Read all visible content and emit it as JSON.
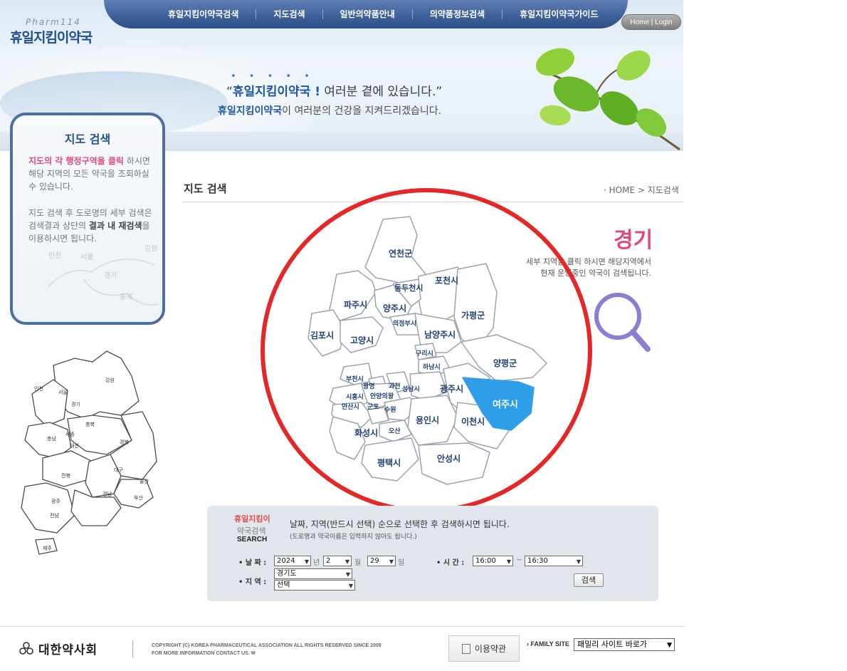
{
  "logo": {
    "sub": "Pharm114",
    "main": "휴일지킴이약국"
  },
  "nav": [
    {
      "label": "휴일지킴이약국검색"
    },
    {
      "label": "지도검색"
    },
    {
      "label": "일반의약품안내"
    },
    {
      "label": "의약품정보검색"
    },
    {
      "label": "휴일지킴이약국가이드"
    }
  ],
  "home_login": "Home | Login",
  "slogan": {
    "dots": "• • • • •",
    "line1_open": "“",
    "line1_brand": "휴일지킴이약국 !",
    "line1_rest": " 여러분 곁에 있습니다.”",
    "line2_brand": "휴일지킴이약국",
    "line2_rest": "이 여러분의 건강을 지켜드리겠습니다."
  },
  "info_box": {
    "title": "지도 검색",
    "p1_highlight": "지도의 각 행정구역을 클릭",
    "p1_rest": " 하시면 해당 지역의 모든 약국을 조회하실 수 있습니다.",
    "p2_a": "지도 검색 후 도로명의 세부 검색은 검색결과 상단의 ",
    "p2_b": "결과 내 재검색",
    "p2_c": "을 이용하시면 됩니다.",
    "faint_labels": [
      "인천",
      "서울",
      "경기",
      "강원",
      "충북"
    ]
  },
  "korea_map": {
    "labels": [
      "인천",
      "서울",
      "경기",
      "강원",
      "충북",
      "충남",
      "세종",
      "대전",
      "경북",
      "전북",
      "대구",
      "울산",
      "광주",
      "경남",
      "부산",
      "전남",
      "제주"
    ]
  },
  "content": {
    "title": "지도 검색",
    "breadcrumb": "·  HOME > 지도검색",
    "region": "경기",
    "region_desc_1": "세부 지역을 클릭 하시면 해당지역에서",
    "region_desc_2": "현재 운영중인 약국이 검색됩니다."
  },
  "gyeonggi_map": {
    "selected": "여주시",
    "regions": [
      "연천군",
      "포천시",
      "동두천시",
      "파주시",
      "양주시",
      "의정부시",
      "가평군",
      "김포시",
      "고양시",
      "남양주시",
      "구리시",
      "양평군",
      "하남시",
      "부천시",
      "광명",
      "과천",
      "시흥시",
      "안양의왕",
      "성남시",
      "광주시",
      "안산시",
      "군포",
      "수원",
      "화성시",
      "오산",
      "용인시",
      "이천시",
      "여주시",
      "평택시",
      "안성시"
    ]
  },
  "search": {
    "label1": "휴일지킴이",
    "label2": "약국검색",
    "label3": "SEARCH",
    "desc": "날짜, 지역(반드시 선택) 순으로 선택한 후 검색하시면 됩니다.",
    "desc_sub": "(도로명과 약국이름은 입력하지 않아도 됩니다.)",
    "date_label": "• 날 짜 :",
    "year": "2024",
    "year_unit": "년",
    "month": "2",
    "month_unit": "월",
    "day": "29",
    "day_unit": "일",
    "time_label": "• 시 간 :",
    "time_from": "16:00",
    "time_sep": "~",
    "time_to": "16:30",
    "region_label": "• 지 역 :",
    "region_value": "경기도",
    "district_value": "선택",
    "button": "검색"
  },
  "footer": {
    "org": "대한약사회",
    "copyright_1": "COPYRIGHT (C) KOREA PHARMACEUTICAL ASSOCIATION ALL RIGHTS RESERVED SINCE 2005",
    "copyright_2": "FOR MORE INFORMATION CONTACT US.",
    "terms": "이용약관",
    "family_label": "› FAMILY SITE",
    "family_select": "패밀리 사이트 바로가"
  },
  "colors": {
    "nav": "#3d5f99",
    "brand_blue": "#1d58a8",
    "pink": "#e04a7a",
    "selected_region": "#2f9ee8",
    "annotation_red": "#e42727"
  }
}
